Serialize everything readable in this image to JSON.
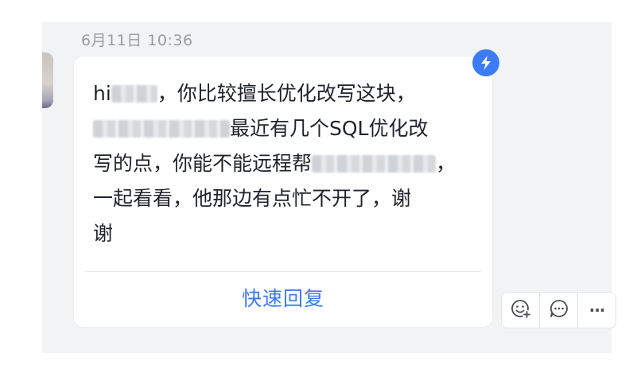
{
  "message": {
    "timestamp": "6月11日 10:36",
    "lines": [
      {
        "before": "hi",
        "after": "，你比较擅长优化改写这块，",
        "redacted_width": 58
      },
      {
        "before": "",
        "after": "最近有几个SQL优化改",
        "redacted_width": 172
      },
      {
        "before": "写的点，你能不能远程帮",
        "after": "，",
        "redacted_width": 156
      },
      {
        "before": "一起看看，他那边有点忙不开了，谢",
        "after": "",
        "redacted_width": 0
      },
      {
        "before": "谢",
        "after": "",
        "redacted_width": 0
      }
    ]
  },
  "quick_reply_label": "快速回复",
  "actions": {
    "more_label": "···"
  },
  "icons": {
    "badge": "lightning-icon",
    "emoji_add": "emoji-add-icon",
    "reply": "comment-icon",
    "more": "more-icon"
  },
  "colors": {
    "accent": "#3c7af0",
    "badge": "#3d7cf7",
    "background": "#f2f3f5",
    "text": "#1f2329",
    "timestamp": "#9a9ca1"
  }
}
